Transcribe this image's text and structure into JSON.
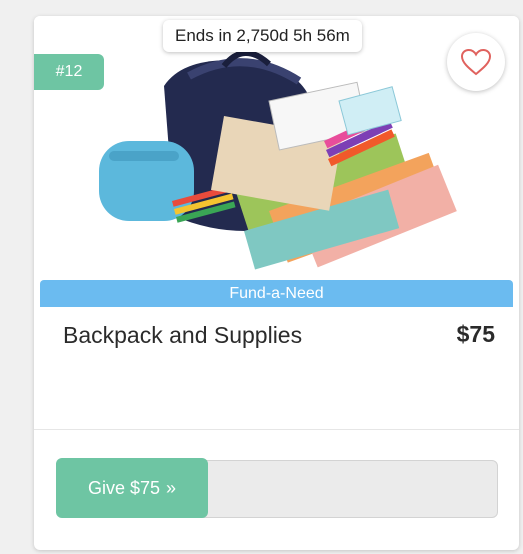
{
  "item": {
    "timer_text": "Ends in 2,750d 5h 56m",
    "rank": "#12",
    "category": "Fund-a-Need",
    "title": "Backpack and Supplies",
    "price": "$75"
  },
  "actions": {
    "give_label": "Give $75",
    "give_chevron": "»"
  },
  "icons": {
    "favorite": "heart-icon",
    "give": "double-chevron-right-icon"
  },
  "colors": {
    "accent_green": "#6ec5a3",
    "category_blue": "#6bbbf0",
    "heart_red": "#e0625e"
  }
}
